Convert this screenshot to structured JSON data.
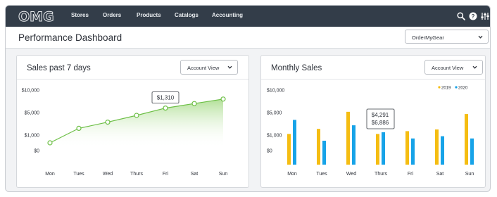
{
  "app": {
    "logo_text": "OMG"
  },
  "nav": {
    "items": [
      {
        "label": "Stores"
      },
      {
        "label": "Orders"
      },
      {
        "label": "Products"
      },
      {
        "label": "Catalogs"
      },
      {
        "label": "Accounting"
      }
    ],
    "icons": [
      "search-icon",
      "help-icon",
      "settings-sliders-icon"
    ]
  },
  "header": {
    "title": "Performance Dashboard",
    "store_select": {
      "value": "OrderMyGear"
    }
  },
  "sales_card": {
    "title": "Sales past 7 days",
    "view_select": {
      "value": "Account View"
    },
    "tooltip": "$1,310"
  },
  "monthly_card": {
    "title": "Monthly Sales",
    "view_select": {
      "value": "Account View"
    },
    "tooltip_lines": [
      "$4,291",
      "$6,886"
    ]
  },
  "chart_data": [
    {
      "type": "area",
      "title": "Sales past 7 days",
      "categories": [
        "Mon",
        "Tues",
        "Wed",
        "Thurs",
        "Fri",
        "Sat",
        "Sun"
      ],
      "y_tick_labels": [
        "$10,000",
        "$5,000",
        "$1,000",
        "$0"
      ],
      "series": [
        {
          "values": [
            500,
            2200,
            3300,
            4500,
            6000,
            7000,
            8000
          ]
        }
      ],
      "colors": {
        "line": "#6cbf45",
        "fill": "#a9dc8c"
      },
      "highlight": {
        "category": "Fri",
        "label": "$1,310"
      },
      "grid": false
    },
    {
      "type": "bar",
      "title": "Monthly Sales",
      "categories": [
        "Mon",
        "Tues",
        "Wed",
        "Thurs",
        "Fri",
        "Sat",
        "Sun"
      ],
      "y_tick_labels": [
        "$10,000",
        "$5,000",
        "$1,000",
        "$0"
      ],
      "series": [
        {
          "name": "2019",
          "color": "#f5bd12",
          "values": [
            3700,
            4600,
            8300,
            3700,
            4200,
            4500,
            7800
          ]
        },
        {
          "name": "2020",
          "color": "#17a3e8",
          "values": [
            6500,
            2500,
            5300,
            4000,
            2900,
            3300,
            2900
          ]
        }
      ],
      "legend": "top-right",
      "highlight": {
        "category": "Thurs",
        "labels": [
          "$4,291",
          "$6,886"
        ]
      },
      "grid": false
    }
  ]
}
